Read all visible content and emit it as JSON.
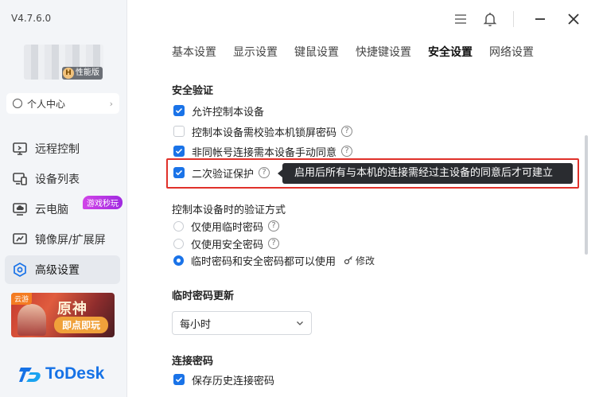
{
  "app": {
    "version": "V4.7.6.0",
    "badge_letter": "H",
    "badge_label": "性能版",
    "profile_label": "个人中心",
    "logo_text": "ToDesk"
  },
  "sidebar": {
    "items": [
      {
        "label": "远程控制",
        "icon": "monitor-icon"
      },
      {
        "label": "设备列表",
        "icon": "devices-icon"
      },
      {
        "label": "云电脑",
        "icon": "cloud-pc-icon"
      },
      {
        "label": "镜像屏/扩展屏",
        "icon": "screen-mirror-icon"
      },
      {
        "label": "高级设置",
        "icon": "settings-hexagon-icon"
      }
    ],
    "game_badge": "游戏秒玩",
    "banner": {
      "tag": "云游",
      "title": "原神",
      "play": "即点即玩"
    }
  },
  "tabs": [
    "基本设置",
    "显示设置",
    "键鼠设置",
    "快捷键设置",
    "安全设置",
    "网络设置"
  ],
  "active_tab": "安全设置",
  "security": {
    "title": "安全验证",
    "options": [
      {
        "label": "允许控制本设备",
        "checked": true
      },
      {
        "label": "控制本设备需校验本机锁屏密码",
        "checked": false
      },
      {
        "label": "非同帐号连接需本设备手动同意",
        "checked": true
      },
      {
        "label": "二次验证保护",
        "checked": true
      }
    ],
    "tooltip": "启用后所有与本机的连接需经过主设备的同意后才可建立"
  },
  "verify_method": {
    "title": "控制本设备时的验证方式",
    "options": [
      {
        "label": "仅使用临时密码",
        "selected": false
      },
      {
        "label": "仅使用安全密码",
        "selected": false
      },
      {
        "label": "临时密码和安全密码都可以使用",
        "selected": true
      }
    ],
    "edit_label": "修改"
  },
  "temp_password": {
    "title": "临时密码更新",
    "selected": "每小时"
  },
  "connection_password": {
    "title": "连接密码",
    "save_history_label": "保存历史连接密码",
    "save_history_checked": true
  },
  "colors": {
    "accent": "#1a73e8",
    "highlight": "#e0312a",
    "logo": "#1672e6"
  }
}
